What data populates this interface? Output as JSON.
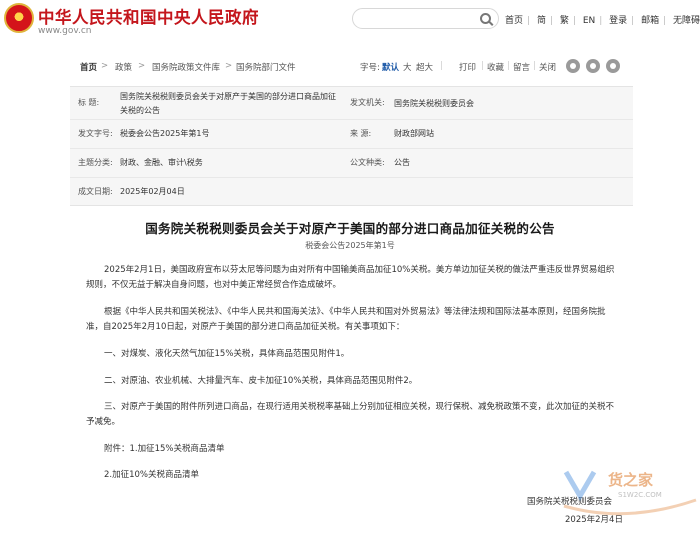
{
  "header": {
    "site_title": "中华人民共和国中央人民政府",
    "domain": "www.gov.cn",
    "search_placeholder": "",
    "nav": [
      "首页",
      "简",
      "繁",
      "EN",
      "登录",
      "邮箱",
      "无障碍"
    ]
  },
  "breadcrumb": {
    "items": [
      "首页",
      "政策",
      "国务院政策文件库",
      "国务院部门文件"
    ],
    "separator": ">"
  },
  "toolbar": {
    "font_label": "字号:",
    "font_default": "默认",
    "font_large": "大",
    "font_xlarge": "超大",
    "print": "打印",
    "favorite": "收藏",
    "message": "留言",
    "close": "关闭"
  },
  "meta": {
    "title_label": "标 题:",
    "title_value": "国务院关税税则委员会关于对原产于美国的部分进口商品加征关税的公告",
    "issuer_label": "发文机关:",
    "issuer_value": "国务院关税税则委员会",
    "docno_label": "发文字号:",
    "docno_value": "税委会公告2025年第1号",
    "source_label": "来 源:",
    "source_value": "财政部网站",
    "topic_label": "主题分类:",
    "topic_value": "财政、金融、审计\\税务",
    "type_label": "公文种类:",
    "type_value": "公告",
    "date_label": "成文日期:",
    "date_value": "2025年02月04日"
  },
  "article": {
    "title": "国务院关税税则委员会关于对原产于美国的部分进口商品加征关税的公告",
    "doc_number": "税委会公告2025年第1号",
    "paragraphs": [
      "2025年2月1日，美国政府宣布以芬太尼等问题为由对所有中国输美商品加征10%关税。美方单边加征关税的做法严重违反世界贸易组织规则，不仅无益于解决自身问题，也对中美正常经贸合作造成破坏。",
      "根据《中华人民共和国关税法》、《中华人民共和国海关法》、《中华人民共和国对外贸易法》等法律法规和国际法基本原则，经国务院批准，自2025年2月10日起，对原产于美国的部分进口商品加征关税。有关事项如下：",
      "一、对煤炭、液化天然气加征15%关税，具体商品范围见附件1。",
      "二、对原油、农业机械、大排量汽车、皮卡加征10%关税，具体商品范围见附件2。",
      "三、对原产于美国的附件所列进口商品，在现行适用关税税率基础上分别加征相应关税，现行保税、减免税政策不变，此次加征的关税不予减免。",
      "附件：1.加征15%关税商品清单",
      "2.加征10%关税商品清单"
    ],
    "signature_org": "国务院关税税则委员会",
    "signature_date": "2025年2月4日"
  },
  "watermark": {
    "text": "货之家",
    "sub": "S1W2C.COM"
  },
  "colors": {
    "brand_red": "#c4161c",
    "link_blue": "#1e5aa8",
    "meta_bg": "#f6f6f6"
  },
  "icons": [
    "national-emblem-icon",
    "search-icon",
    "weibo-icon",
    "wechat-icon",
    "share-icon"
  ]
}
